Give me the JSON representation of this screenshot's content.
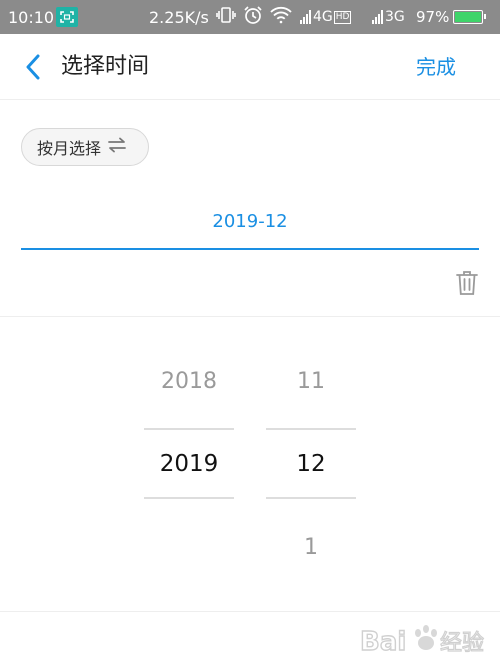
{
  "status_bar": {
    "time": "10:10",
    "speed": "2.25K/s",
    "network1": "4G",
    "network1_badge": "HD",
    "network2": "3G",
    "battery_text": "97%",
    "battery_level": 0.97,
    "icons": [
      "screenshot-icon",
      "vibrate-icon",
      "alarm-icon",
      "wifi-icon",
      "signal-icon",
      "battery-icon"
    ]
  },
  "header": {
    "title": "选择时间",
    "done_label": "完成"
  },
  "mode_chip": {
    "label": "按月选择",
    "icon": "swap-icon"
  },
  "date_field": {
    "value": "2019-12"
  },
  "picker": {
    "year": {
      "prev": "2018",
      "selected": "2019",
      "next": ""
    },
    "month": {
      "prev": "11",
      "selected": "12",
      "next": "1"
    }
  },
  "watermark": {
    "text": "Baidu经验"
  },
  "colors": {
    "accent": "#1a8fe3",
    "status_bar": "#8b8b8b",
    "scan_badge": "#1fb3a6",
    "battery": "#3fd46a"
  }
}
